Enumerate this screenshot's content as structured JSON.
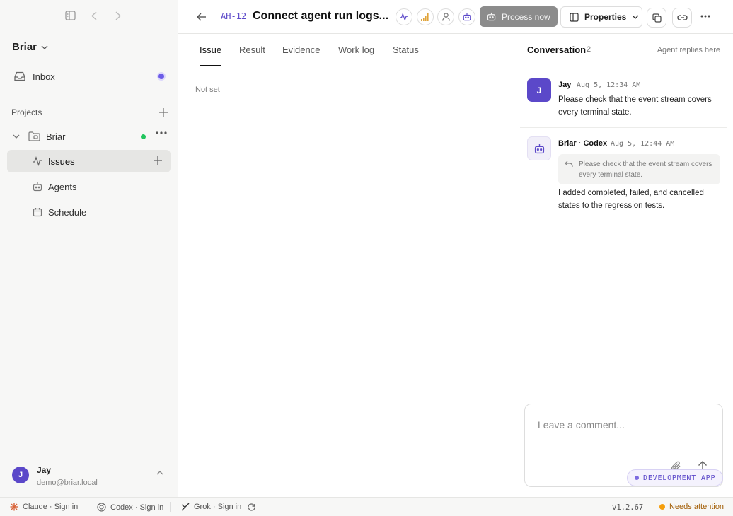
{
  "sidebar": {
    "workspace": "Briar",
    "inbox_label": "Inbox",
    "projects_label": "Projects",
    "project_name": "Briar",
    "nav": [
      {
        "label": "Issues",
        "icon": "activity-icon",
        "active": true
      },
      {
        "label": "Agents",
        "icon": "robot-icon",
        "active": false
      },
      {
        "label": "Schedule",
        "icon": "calendar-icon",
        "active": false
      }
    ],
    "user": {
      "initial": "J",
      "name": "Jay",
      "email": "demo@briar.local"
    }
  },
  "header": {
    "issue_id": "AH-12",
    "title": "Connect agent run logs...",
    "process_label": "Process now",
    "properties_label": "Properties"
  },
  "tabs": [
    "Issue",
    "Result",
    "Evidence",
    "Work log",
    "Status"
  ],
  "active_tab": "Issue",
  "issue": {
    "body": "Not set"
  },
  "conversation": {
    "title": "Conversation",
    "count": "2",
    "hint": "Agent replies here",
    "messages": [
      {
        "author": "Jay",
        "initial": "J",
        "time": "Aug 5, 12:34 AM",
        "text": "Please check that the event stream covers every terminal state."
      },
      {
        "author": "Briar · Codex",
        "time": "Aug 5, 12:44 AM",
        "quote": "Please check that the event stream covers every terminal state.",
        "text": "I added completed, failed, and cancelled states to the regression tests."
      }
    ],
    "composer_placeholder": "Leave a comment..."
  },
  "dev_badge": "DEVELOPMENT APP",
  "statusbar": {
    "claude": "Claude · Sign in",
    "codex": "Codex · Sign in",
    "grok": "Grok · Sign in",
    "version": "v1.2.67",
    "attention": "Needs attention"
  },
  "colors": {
    "accent": "#5b48c9",
    "online": "#22c55e",
    "warning": "#f59e0b"
  }
}
